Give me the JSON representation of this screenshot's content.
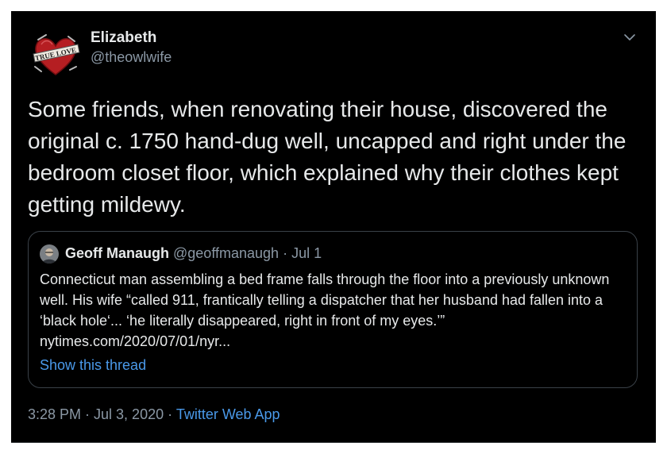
{
  "tweet": {
    "author": {
      "display_name": "Elizabeth",
      "handle": "@theowlwife",
      "avatar_icon": "heart-banner-avatar-icon",
      "avatar_text": "TRUE LOVE"
    },
    "text": "Some friends, when renovating their house, discovered the original c. 1750 hand-dug well, uncapped and right under the bedroom closet floor, which explained why their clothes kept getting mildewy.",
    "more_icon": "chevron-down-icon",
    "timestamp": "3:28 PM · Jul 3, 2020",
    "separator": "·",
    "source_app": "Twitter Web App"
  },
  "quoted_tweet": {
    "author_name": "Geoff Manaugh",
    "author_handle": "@geoffmanaugh",
    "dot": "·",
    "date": "Jul 1",
    "text": "Connecticut man assembling a bed frame falls through the floor into a previously unknown well. His wife “called 911, frantically telling a dispatcher that her husband had fallen into a ‘black hole‘... ‘he literally disappeared, right in front of my eyes.’” nytimes.com/2020/07/01/nyr...",
    "show_thread_label": "Show this thread"
  },
  "colors": {
    "background": "#000000",
    "primary_text": "#e7e9ea",
    "secondary_text": "#8b98a5",
    "link": "#4a99e9",
    "border": "#3a4148"
  }
}
